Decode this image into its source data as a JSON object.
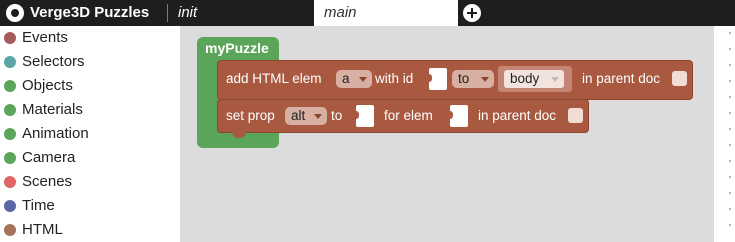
{
  "app": {
    "title": "Verge3D Puzzles"
  },
  "tabs": [
    {
      "label": "init",
      "active": false
    },
    {
      "label": "main",
      "active": true
    }
  ],
  "sidebar": {
    "items": [
      {
        "label": "Events",
        "color": "#a55b5b"
      },
      {
        "label": "Selectors",
        "color": "#5ba5a5"
      },
      {
        "label": "Objects",
        "color": "#5ba55b"
      },
      {
        "label": "Materials",
        "color": "#5ba55b"
      },
      {
        "label": "Animation",
        "color": "#5ba55b"
      },
      {
        "label": "Camera",
        "color": "#5ba55b"
      },
      {
        "label": "Scenes",
        "color": "#e06666"
      },
      {
        "label": "Time",
        "color": "#5b67a5"
      },
      {
        "label": "HTML",
        "color": "#a5745b"
      }
    ]
  },
  "workspace": {
    "procedure": {
      "name": "myPuzzle",
      "color": "#5ba55b"
    },
    "block_add_html": {
      "label_add": "add HTML elem",
      "elem_dropdown": "a",
      "label_with_id": "with id",
      "to_dropdown": "to",
      "text_value": "body",
      "label_parent_doc": "in parent doc",
      "color": "#a8593f"
    },
    "block_set_prop": {
      "label_set": "set prop",
      "prop_dropdown": "alt",
      "label_to": "to",
      "label_for_elem": "for elem",
      "label_parent_doc": "in parent doc"
    }
  }
}
